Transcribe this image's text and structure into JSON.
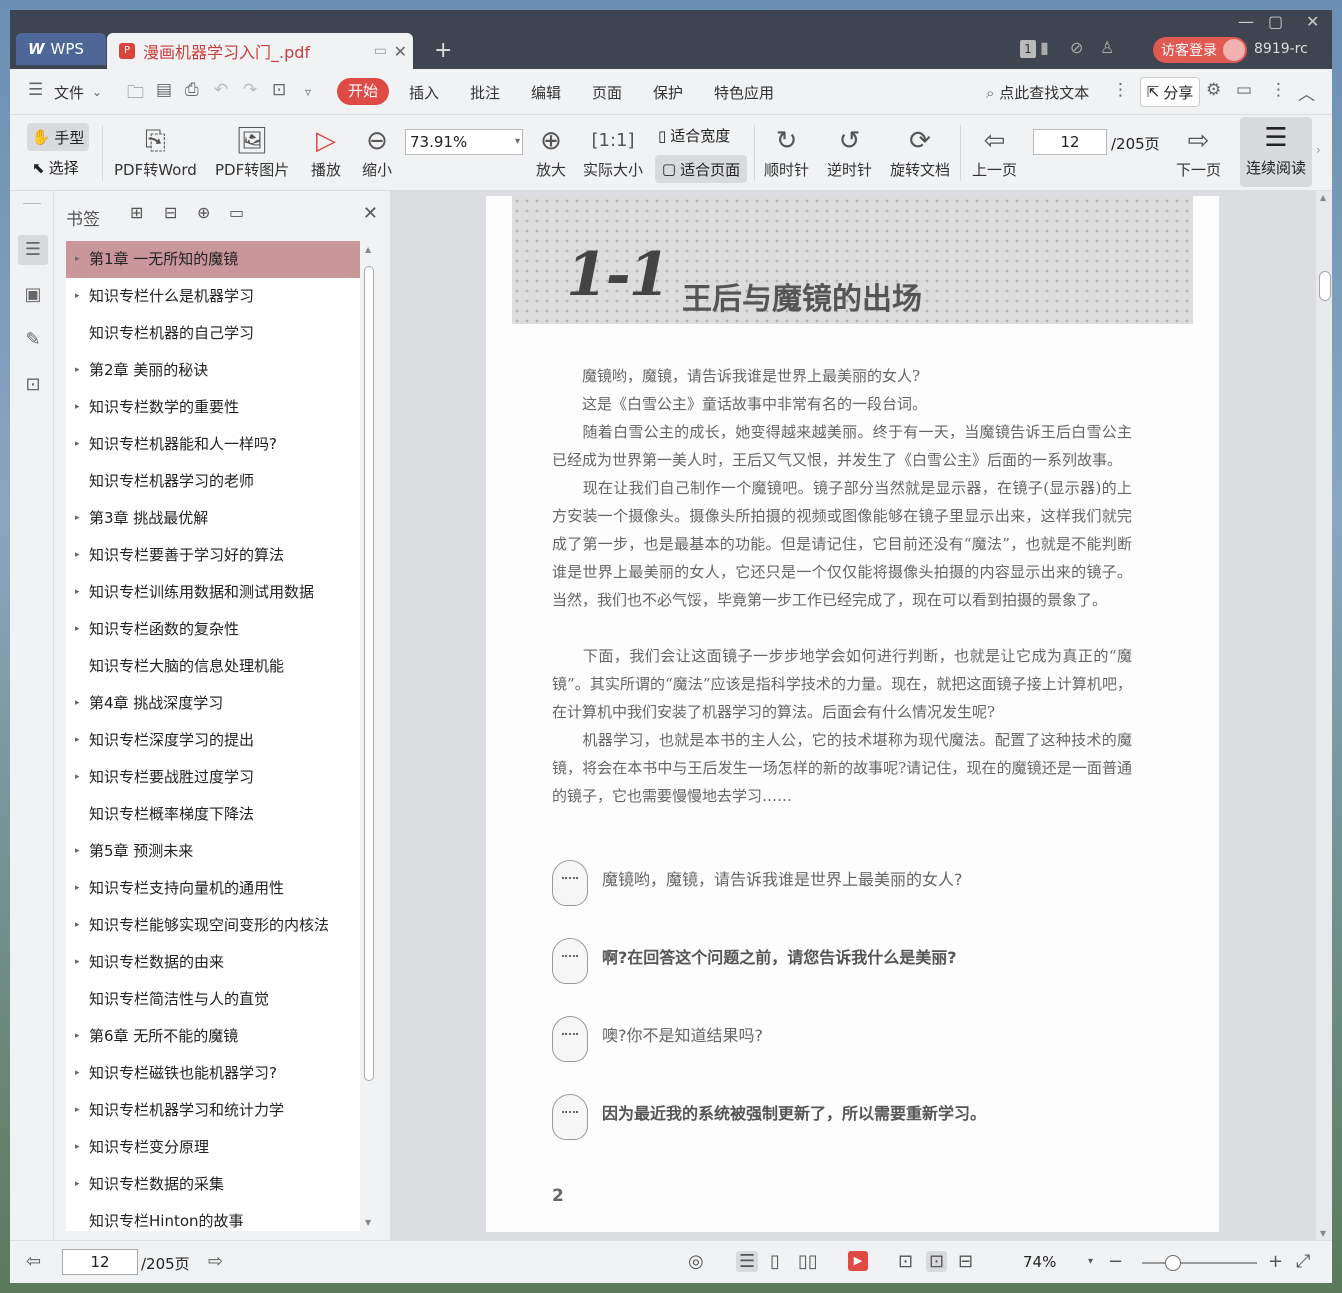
{
  "titlebar": {
    "app_tab": "WPS",
    "doc_tab": "漫画机器学习入门_.pdf",
    "badge": "1",
    "login": "访客登录",
    "version": "8919-rc"
  },
  "menu": {
    "file": "文件",
    "items": [
      "开始",
      "插入",
      "批注",
      "编辑",
      "页面",
      "保护",
      "特色应用"
    ],
    "search": "点此查找文本",
    "share": "分享"
  },
  "toolbar": {
    "hand": "手型",
    "select": "选择",
    "pdf_word": "PDF转Word",
    "pdf_image": "PDF转图片",
    "play": "播放",
    "zoom_out": "缩小",
    "zoom_value": "73.91%",
    "zoom_in": "放大",
    "actual_size": "实际大小",
    "fit_width": "适合宽度",
    "fit_page": "适合页面",
    "clockwise": "顺时针",
    "counterclockwise": "逆时针",
    "rotate_doc": "旋转文档",
    "prev_page": "上一页",
    "page_input": "12",
    "page_total": "/205页",
    "next_page": "下一页",
    "continuous": "连续阅读"
  },
  "bookmarks": {
    "title": "书签",
    "items": [
      {
        "label": "第1章 一无所知的魔镜",
        "arrow": "▸",
        "selected": true
      },
      {
        "label": "知识专栏什么是机器学习",
        "arrow": "▸"
      },
      {
        "label": "知识专栏机器的自己学习",
        "arrow": ""
      },
      {
        "label": "第2章 美丽的秘诀",
        "arrow": "▸"
      },
      {
        "label": "知识专栏数学的重要性",
        "arrow": "▸"
      },
      {
        "label": "知识专栏机器能和人一样吗?",
        "arrow": "▸"
      },
      {
        "label": "知识专栏机器学习的老师",
        "arrow": ""
      },
      {
        "label": "第3章 挑战最优解",
        "arrow": "▸"
      },
      {
        "label": "知识专栏要善于学习好的算法",
        "arrow": "▸"
      },
      {
        "label": "知识专栏训练用数据和测试用数据",
        "arrow": "▸"
      },
      {
        "label": "知识专栏函数的复杂性",
        "arrow": "▸"
      },
      {
        "label": "知识专栏大脑的信息处理机能",
        "arrow": ""
      },
      {
        "label": "第4章 挑战深度学习",
        "arrow": "▸"
      },
      {
        "label": "知识专栏深度学习的提出",
        "arrow": "▸"
      },
      {
        "label": "知识专栏要战胜过度学习",
        "arrow": "▸"
      },
      {
        "label": "知识专栏概率梯度下降法",
        "arrow": ""
      },
      {
        "label": "第5章 预测未来",
        "arrow": "▸"
      },
      {
        "label": "知识专栏支持向量机的通用性",
        "arrow": "▸"
      },
      {
        "label": "知识专栏能够实现空间变形的内核法",
        "arrow": "▸"
      },
      {
        "label": "知识专栏数据的由来",
        "arrow": "▸"
      },
      {
        "label": "知识专栏简洁性与人的直觉",
        "arrow": ""
      },
      {
        "label": "第6章 无所不能的魔镜",
        "arrow": "▸"
      },
      {
        "label": "知识专栏磁铁也能机器学习?",
        "arrow": "▸"
      },
      {
        "label": "知识专栏机器学习和统计力学",
        "arrow": "▸"
      },
      {
        "label": "知识专栏变分原理",
        "arrow": "▸"
      },
      {
        "label": "知识专栏数据的采集",
        "arrow": "▸"
      },
      {
        "label": "知识专栏Hinton的故事",
        "arrow": ""
      }
    ]
  },
  "document": {
    "section_number": "1-1",
    "section_title": "王后与魔镜的出场",
    "paragraphs": [
      "　　魔镜哟，魔镜，请告诉我谁是世界上最美丽的女人?",
      "　　这是《白雪公主》童话故事中非常有名的一段台词。",
      "　　随着白雪公主的成长，她变得越来越美丽。终于有一天，当魔镜告诉王后白雪公主已经成为世界第一美人时，王后又气又恨，并发生了《白雪公主》后面的一系列故事。",
      "　　现在让我们自己制作一个魔镜吧。镜子部分当然就是显示器，在镜子(显示器)的上方安装一个摄像头。摄像头所拍摄的视频或图像能够在镜子里显示出来，这样我们就完成了第一步，也是最基本的功能。但是请记住，它目前还没有“魔法”，也就是不能判断谁是世界上最美丽的女人，它还只是一个仅仅能将摄像头拍摄的内容显示出来的镜子。当然，我们也不必气馁，毕竟第一步工作已经完成了，现在可以看到拍摄的景象了。",
      "　　下面，我们会让这面镜子一步步地学会如何进行判断，也就是让它成为真正的“魔镜”。其实所谓的“魔法”应该是指科学技术的力量。现在，就把这面镜子接上计算机吧，在计算机中我们安装了机器学习的算法。后面会有什么情况发生呢?",
      "　　机器学习，也就是本书的主人公，它的技术堪称为现代魔法。配置了这种技术的魔镜，将会在本书中与王后发生一场怎样的新的故事呢?请记住，现在的魔镜还是一面普通的镜子，它也需要慢慢地去学习……"
    ],
    "dialogues": [
      {
        "speaker": "queen",
        "text": "魔镜哟，魔镜，请告诉我谁是世界上最美丽的女人?",
        "bold": false
      },
      {
        "speaker": "mirror",
        "text": "啊?在回答这个问题之前，请您告诉我什么是美丽?",
        "bold": true
      },
      {
        "speaker": "queen",
        "text": "噢?你不是知道结果吗?",
        "bold": false
      },
      {
        "speaker": "mirror",
        "text": "因为最近我的系统被强制更新了，所以需要重新学习。",
        "bold": true
      }
    ],
    "page_number": "2"
  },
  "statusbar": {
    "page_input": "12",
    "page_total": "/205页",
    "zoom": "74%",
    "zoom_slider_fraction": 0.27
  }
}
